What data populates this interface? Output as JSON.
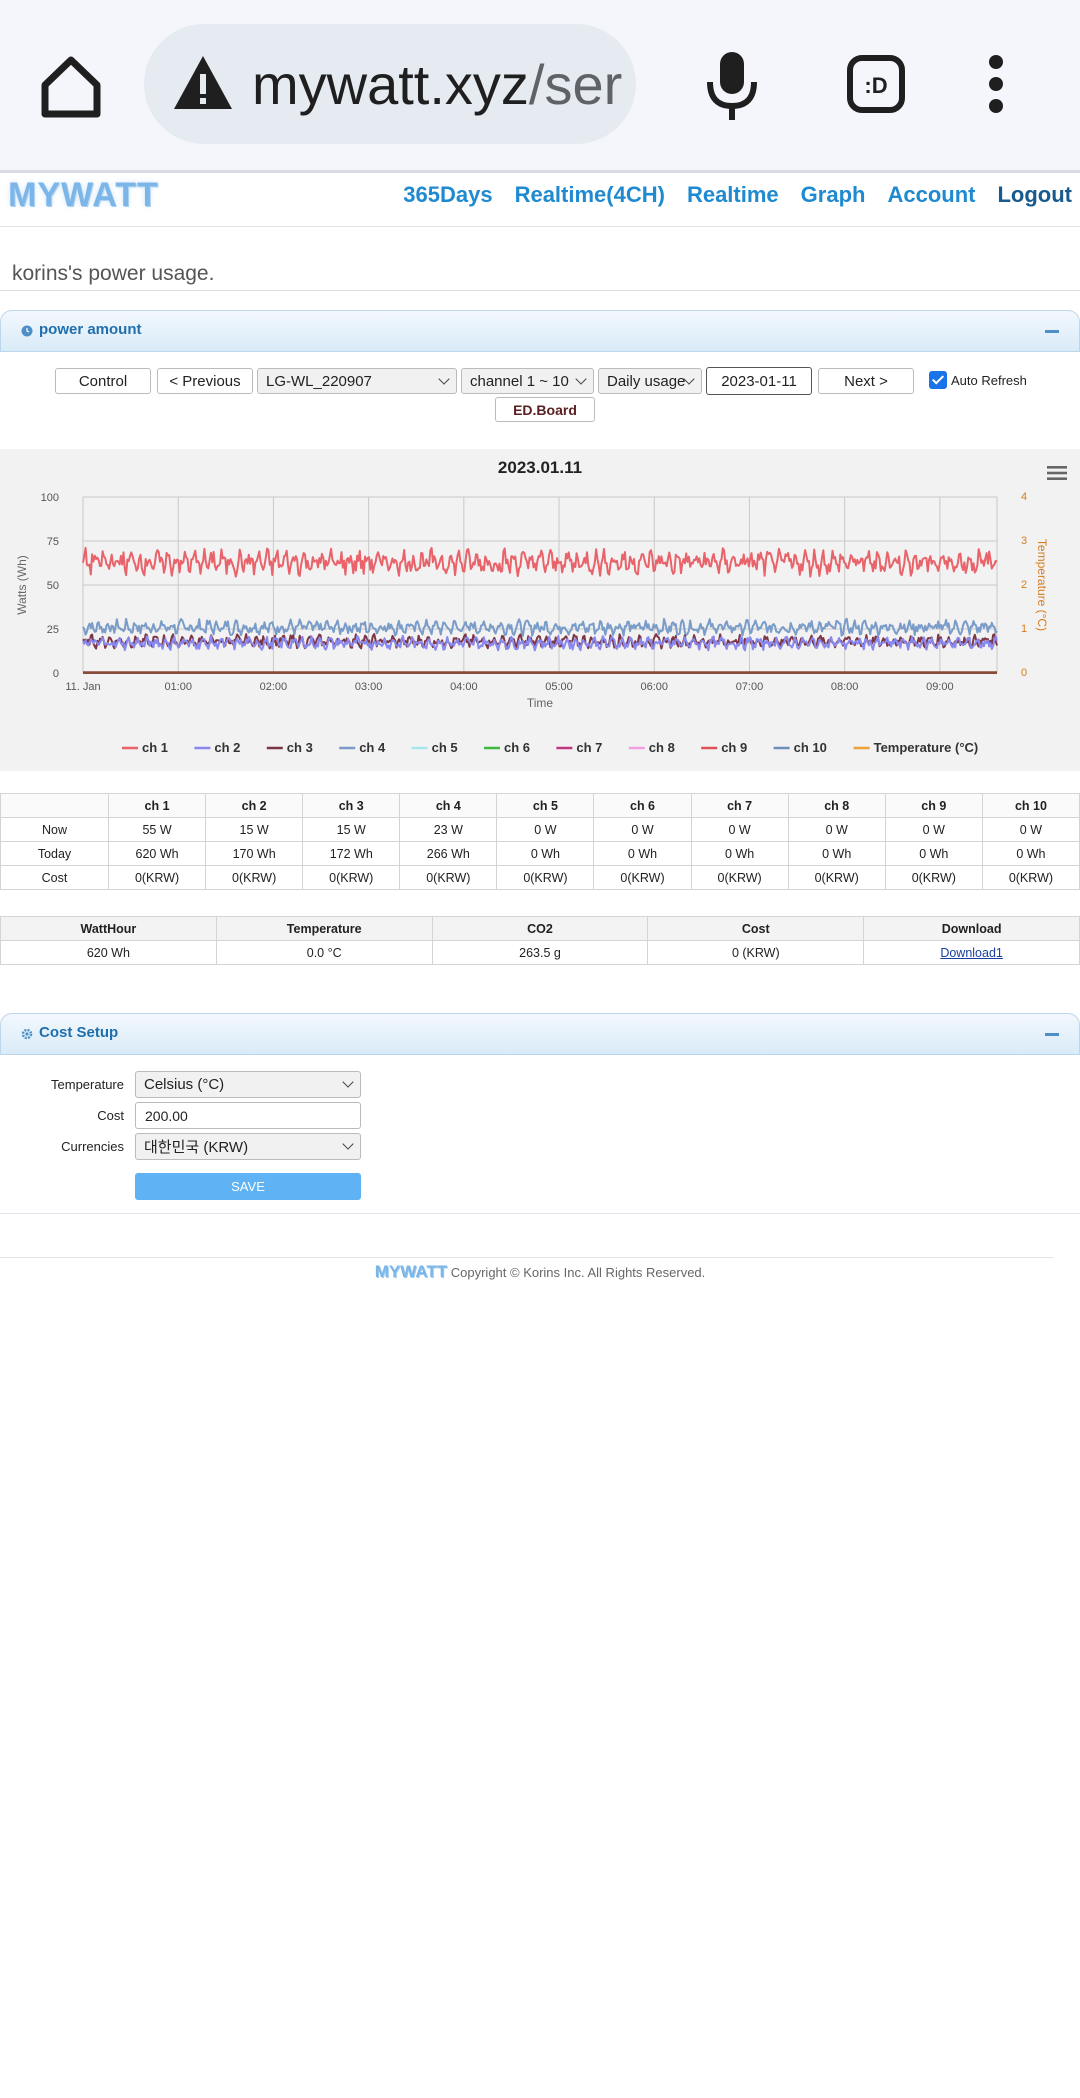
{
  "browser": {
    "url_host": "mywatt.xyz",
    "url_path": "/ser"
  },
  "site": {
    "logo": "MYWATT",
    "nav": [
      "365Days",
      "Realtime(4CH)",
      "Realtime",
      "Graph",
      "Account",
      "Logout"
    ],
    "subtitle": "korins's power usage."
  },
  "power_panel": {
    "title": "power amount",
    "control_btn": "Control",
    "prev_btn": "< Previous",
    "device_select": "LG-WL_220907",
    "channel_select": "channel 1 ~ 10",
    "mode_select": "Daily usage",
    "date_value": "2023-01-11",
    "next_btn": "Next >",
    "auto_refresh_label": "Auto Refresh",
    "auto_refresh_checked": true,
    "edboard_btn": "ED.Board"
  },
  "chart_data": {
    "type": "line",
    "title": "2023.01.11",
    "xlabel": "Time",
    "ylabel": "Watts (Wh)",
    "y2label": "Temperature (°C)",
    "ylim": [
      0,
      100
    ],
    "y2lim": [
      0,
      4
    ],
    "yticks": [
      "0",
      "25",
      "50",
      "75",
      "100"
    ],
    "y2ticks": [
      "0",
      "1",
      "2",
      "3",
      "4"
    ],
    "xticks": [
      "11. Jan",
      "01:00",
      "02:00",
      "03:00",
      "04:00",
      "05:00",
      "06:00",
      "07:00",
      "08:00",
      "09:00"
    ],
    "x_range_hours": [
      0,
      9.6
    ],
    "legend_position": "bottom",
    "grid": true,
    "series": [
      {
        "name": "ch 1",
        "color": "#e8636a",
        "mean": 63,
        "amp": 6
      },
      {
        "name": "ch 2",
        "color": "#8888ee",
        "mean": 17,
        "amp": 3
      },
      {
        "name": "ch 3",
        "color": "#7d3645",
        "mean": 18,
        "amp": 3
      },
      {
        "name": "ch 4",
        "color": "#7a9cc8",
        "mean": 26,
        "amp": 3.5
      },
      {
        "name": "ch 5",
        "color": "#a8e6ea",
        "mean": 0,
        "amp": 0
      },
      {
        "name": "ch 6",
        "color": "#3fb83f",
        "mean": 0,
        "amp": 0
      },
      {
        "name": "ch 7",
        "color": "#c2367f",
        "mean": 0,
        "amp": 0
      },
      {
        "name": "ch 8",
        "color": "#f0a0e0",
        "mean": 0,
        "amp": 0
      },
      {
        "name": "ch 9",
        "color": "#e0505a",
        "mean": 0,
        "amp": 0
      },
      {
        "name": "ch 10",
        "color": "#6f8fb8",
        "mean": 0,
        "amp": 0
      },
      {
        "name": "Temperature (°C)",
        "color": "#e9a33a",
        "mean": 0,
        "amp": 0,
        "axis": "y2"
      }
    ]
  },
  "stats_table": {
    "headers": [
      "",
      "ch 1",
      "ch 2",
      "ch 3",
      "ch 4",
      "ch 5",
      "ch 6",
      "ch 7",
      "ch 8",
      "ch 9",
      "ch 10"
    ],
    "rows": [
      [
        "Now",
        "55 W",
        "15 W",
        "15 W",
        "23 W",
        "0 W",
        "0 W",
        "0 W",
        "0 W",
        "0 W",
        "0 W"
      ],
      [
        "Today",
        "620 Wh",
        "170 Wh",
        "172 Wh",
        "266 Wh",
        "0 Wh",
        "0 Wh",
        "0 Wh",
        "0 Wh",
        "0 Wh",
        "0 Wh"
      ],
      [
        "Cost",
        "0(KRW)",
        "0(KRW)",
        "0(KRW)",
        "0(KRW)",
        "0(KRW)",
        "0(KRW)",
        "0(KRW)",
        "0(KRW)",
        "0(KRW)",
        "0(KRW)"
      ]
    ]
  },
  "summary_table": {
    "headers": [
      "WattHour",
      "Temperature",
      "CO2",
      "Cost",
      "Download"
    ],
    "values": [
      "620 Wh",
      "0.0 °C",
      "263.5 g",
      "0 (KRW)",
      "Download1"
    ]
  },
  "cost_panel": {
    "title": "Cost Setup",
    "temperature_label": "Temperature",
    "temperature_value": "Celsius (°C)",
    "cost_label": "Cost",
    "cost_value": "200.00",
    "currency_label": "Currencies",
    "currency_value": "대한민국 (KRW)",
    "save_btn": "SAVE"
  },
  "footer": {
    "logo": "MYWATT",
    "copyright": "Copyright © Korins Inc. All Rights Reserved."
  }
}
